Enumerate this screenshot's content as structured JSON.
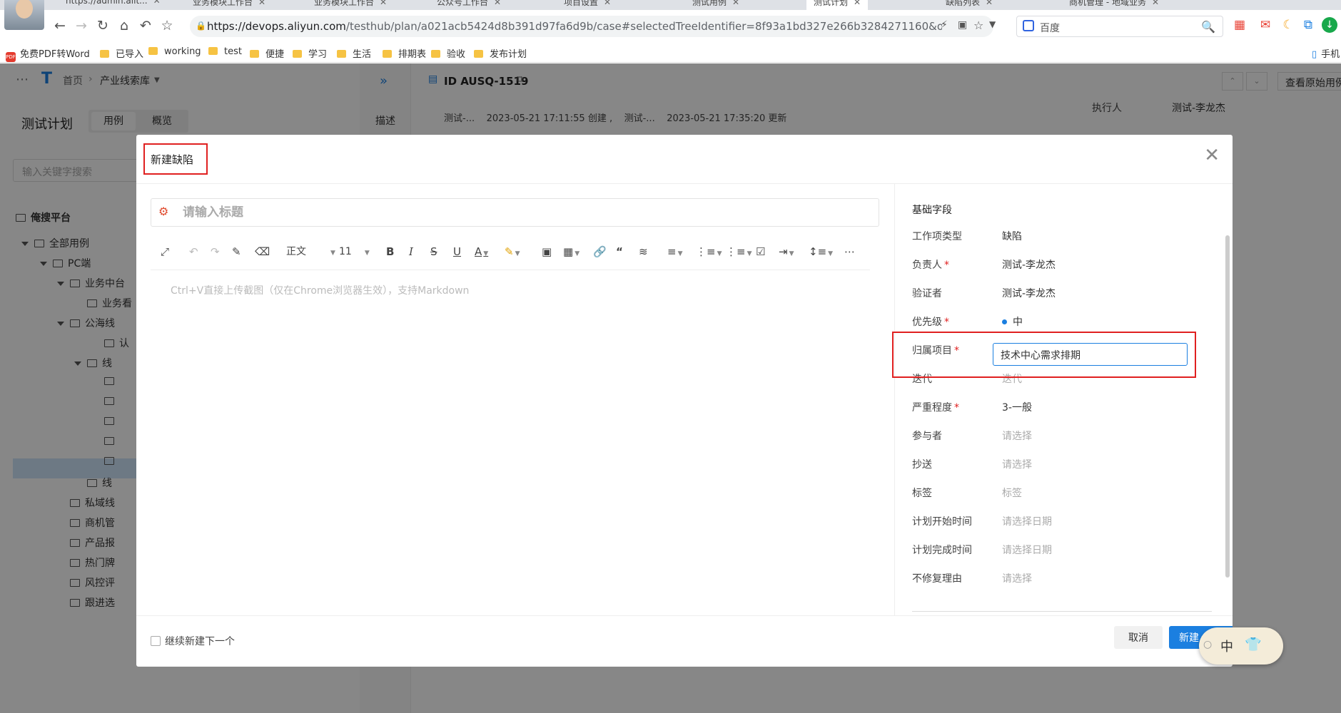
{
  "browser": {
    "tabs": [
      {
        "label": "https://admin.alit...",
        "active": false
      },
      {
        "label": "业务模块工作台",
        "active": false
      },
      {
        "label": "业务模块工作台",
        "active": false
      },
      {
        "label": "公众号工作台",
        "active": false
      },
      {
        "label": "项目设置",
        "active": false
      },
      {
        "label": "测试用例",
        "active": false
      },
      {
        "label": "测试计划",
        "active": true
      },
      {
        "label": "缺陷列表",
        "active": false
      },
      {
        "label": "商机管理 - 地域业务",
        "active": false
      }
    ],
    "url_host": "https://devops.aliyun.com",
    "url_path": "/testhub/plan/a021acb5424d8b391d97fa6d9b/case#selectedTreeIdentifier=8f93a1bd327e266b3284271160&openWorkite...",
    "search_engine": "百度",
    "bookmarks": [
      {
        "label": "免费PDF转Word",
        "icon": "pdf"
      },
      {
        "label": "已导入",
        "icon": "folder"
      },
      {
        "label": "working",
        "icon": "folder"
      },
      {
        "label": "test",
        "icon": "folder"
      },
      {
        "label": "便捷",
        "icon": "folder"
      },
      {
        "label": "学习",
        "icon": "folder"
      },
      {
        "label": "生活",
        "icon": "folder"
      },
      {
        "label": "排期表",
        "icon": "folder"
      },
      {
        "label": "验收",
        "icon": "folder"
      },
      {
        "label": "发布计划",
        "icon": "folder"
      }
    ],
    "bookmarks_right": "手机"
  },
  "app": {
    "breadcrumb_home": "首页",
    "breadcrumb_project": "产业线索库",
    "page_title": "测试计划",
    "tabs": [
      "用例",
      "概览"
    ],
    "search_placeholder": "输入关键字搜索",
    "tree_root": "俺搜平台",
    "tree": [
      {
        "label": "全部用例",
        "level": 1,
        "expanded": true
      },
      {
        "label": "PC端",
        "level": 2,
        "expanded": true
      },
      {
        "label": "业务中台",
        "level": 3,
        "expanded": true
      },
      {
        "label": "业务看",
        "level": 4,
        "expanded": false
      },
      {
        "label": "公海线",
        "level": 3,
        "expanded": true
      },
      {
        "label": "认",
        "level": 5,
        "expanded": false
      },
      {
        "label": "线",
        "level": 4,
        "expanded": true
      },
      {
        "label": "",
        "level": 5,
        "expanded": false
      },
      {
        "label": "",
        "level": 5,
        "expanded": false
      },
      {
        "label": "",
        "level": 5,
        "expanded": false,
        "selected": true
      },
      {
        "label": "",
        "level": 5,
        "expanded": false
      },
      {
        "label": "",
        "level": 5,
        "expanded": false
      },
      {
        "label": "线",
        "level": 4,
        "expanded": false
      },
      {
        "label": "私域线",
        "level": 3,
        "expanded": false
      },
      {
        "label": "商机管",
        "level": 3,
        "expanded": false
      },
      {
        "label": "产品报",
        "level": 3,
        "expanded": false
      },
      {
        "label": "热门牌",
        "level": 3,
        "expanded": false
      },
      {
        "label": "风控评",
        "level": 3,
        "expanded": false
      },
      {
        "label": "跟进选",
        "level": 3,
        "expanded": false
      }
    ],
    "side_desc": "描述",
    "detail_id": "ID AUSQ-1519",
    "detail_meta": "测试-...    2023-05-21 17:11:55 创建 ,    测试-...    2023-05-21 17:35:20 更新",
    "view_original": "查看原始用例",
    "executor_label": "执行人",
    "executor_value": "测试-李龙杰"
  },
  "modal": {
    "title": "新建缺陷",
    "title_placeholder": "请输入标题",
    "toolbar": {
      "paragraph": "正文",
      "font_size": "11"
    },
    "editor_placeholder": "Ctrl+V直接上传截图（仅在Chrome浏览器生效），支持Markdown",
    "section": "基础字段",
    "fields": [
      {
        "label": "工作项类型",
        "value": "缺陷",
        "required": false,
        "placeholder": false
      },
      {
        "label": "负责人",
        "value": "测试-李龙杰",
        "required": true,
        "placeholder": false
      },
      {
        "label": "验证者",
        "value": "测试-李龙杰",
        "required": false,
        "placeholder": false
      },
      {
        "label": "优先级",
        "value": "中",
        "required": true,
        "placeholder": false
      },
      {
        "label": "归属项目",
        "value": "技术中心需求排期",
        "required": true,
        "placeholder": false
      },
      {
        "label": "迭代",
        "value": "迭代",
        "required": false,
        "placeholder": true
      },
      {
        "label": "严重程度",
        "value": "3-一般",
        "required": true,
        "placeholder": false
      },
      {
        "label": "参与者",
        "value": "请选择",
        "required": false,
        "placeholder": true
      },
      {
        "label": "抄送",
        "value": "请选择",
        "required": false,
        "placeholder": true
      },
      {
        "label": "标签",
        "value": "标签",
        "required": false,
        "placeholder": true
      },
      {
        "label": "计划开始时间",
        "value": "请选择日期",
        "required": false,
        "placeholder": true
      },
      {
        "label": "计划完成时间",
        "value": "请选择日期",
        "required": false,
        "placeholder": true
      },
      {
        "label": "不修复理由",
        "value": "请选择",
        "required": false,
        "placeholder": true
      }
    ],
    "continue_label": "继续新建下一个",
    "cancel": "取消",
    "create": "新建"
  },
  "ime": {
    "label": "中"
  },
  "colors": {
    "primary": "#1b7fe0",
    "highlight": "#e02020",
    "required": "#e02020"
  }
}
